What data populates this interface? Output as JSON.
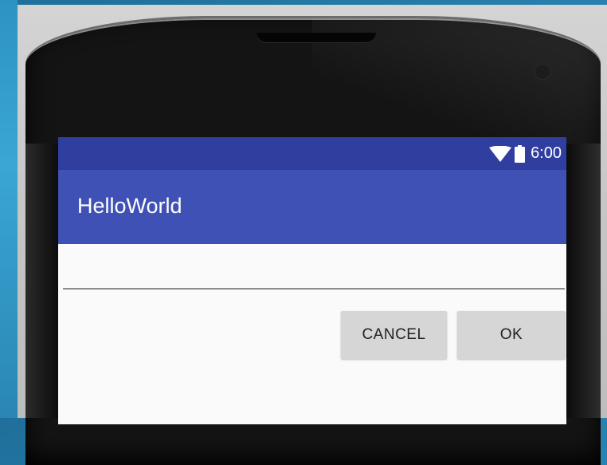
{
  "status_bar": {
    "time": "6:00",
    "icons": [
      "wifi-icon",
      "battery-icon"
    ]
  },
  "toolbar": {
    "title": "HelloWorld"
  },
  "dialog": {
    "input_value": "",
    "cancel_label": "CANCEL",
    "ok_label": "OK"
  },
  "colors": {
    "status_bar": "#303f9f",
    "toolbar": "#3f51b5",
    "content": "#fafafa",
    "button": "#d6d6d6"
  }
}
